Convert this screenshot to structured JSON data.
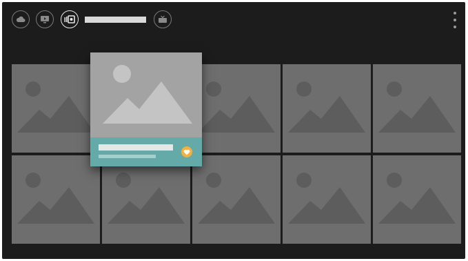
{
  "header": {
    "title": "",
    "nav_icons": [
      "cloud-icon",
      "media-player-icon",
      "photo-library-icon",
      "tv-icon"
    ],
    "active_icon": "photo-library-icon"
  },
  "grid": {
    "rows": 2,
    "columns": 5,
    "focused": {
      "row": 1,
      "column": 2,
      "favorite": true
    }
  },
  "colors": {
    "background": "#1c1c1c",
    "tile": "#6e6e6e",
    "focused_tile": "#a3a3a3",
    "info_bar": "#63aaa8",
    "favorite": "#f3b13a"
  }
}
